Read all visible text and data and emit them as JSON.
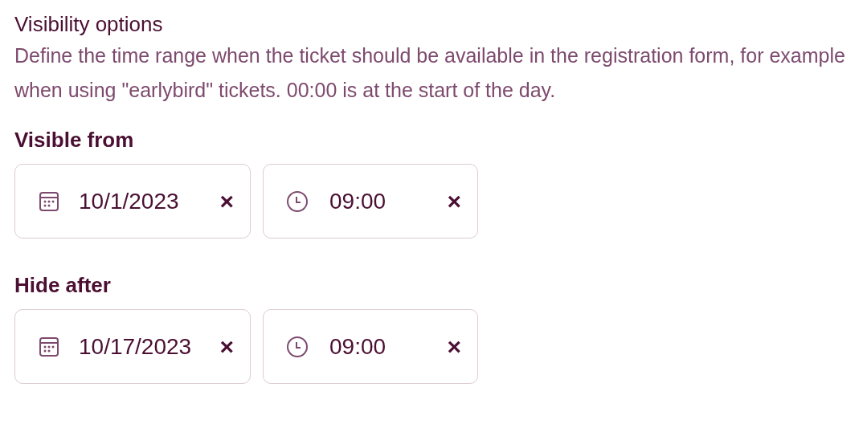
{
  "section": {
    "title": "Visibility options",
    "description": "Define the time range when the ticket should be available in the registration form, for example when using \"earlybird\" tickets. 00:00 is at the start of the day."
  },
  "groups": [
    {
      "label": "Visible from",
      "date": "10/1/2023",
      "time": "09:00",
      "clear": "×"
    },
    {
      "label": "Hide after",
      "date": "10/17/2023",
      "time": "09:00",
      "clear": "×"
    }
  ]
}
